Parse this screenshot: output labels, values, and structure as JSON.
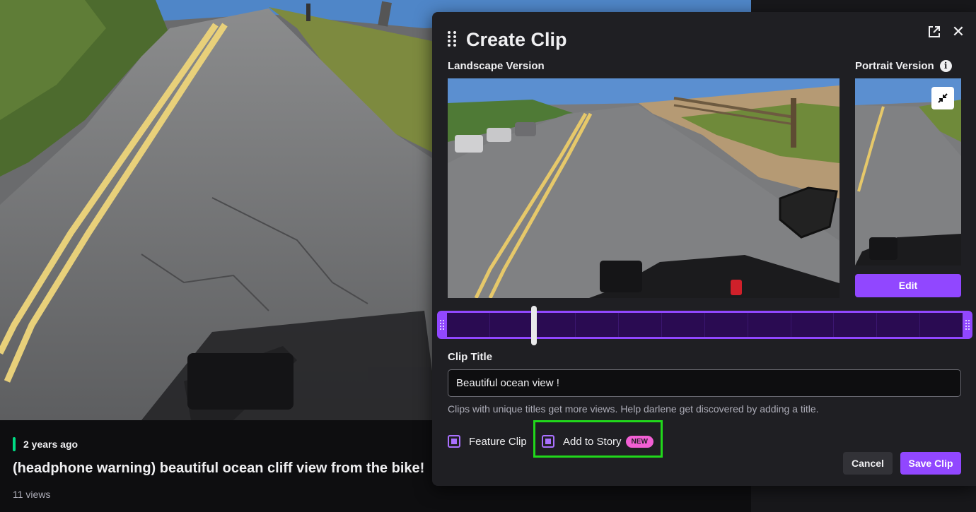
{
  "background": {
    "age_text": "2 years ago",
    "title": "(headphone warning) beautiful ocean cliff view from the bike!",
    "views": "11 views"
  },
  "modal": {
    "title": "Create Clip",
    "landscape_label": "Landscape Version",
    "portrait_label": "Portrait Version",
    "edit_label": "Edit",
    "clip_title_label": "Clip Title",
    "clip_title_value": "Beautiful ocean view !",
    "clip_hint": "Clips with unique titles get more views. Help darlene get discovered by adding a title.",
    "feature_label": "Feature Clip",
    "story_label": "Add to Story",
    "new_badge": "NEW",
    "cancel_label": "Cancel",
    "save_label": "Save Clip"
  },
  "colors": {
    "accent": "#9147ff",
    "highlight": "#21d81b",
    "badge": "#f25fd4",
    "live_bar": "#00db84"
  },
  "icons": {
    "drag": "drag-handle-icon",
    "popout": "popout-icon",
    "close": "close-icon",
    "info": "info-icon",
    "collapse": "collapse-icon"
  }
}
